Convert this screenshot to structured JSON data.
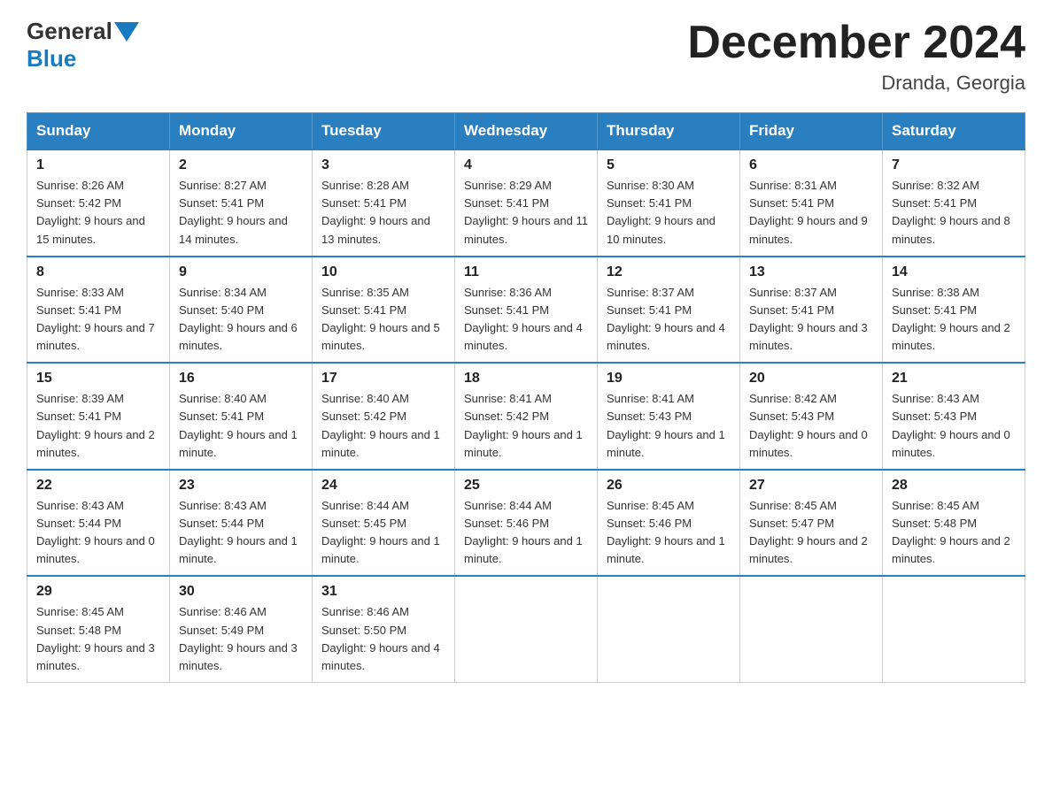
{
  "header": {
    "title": "December 2024",
    "location": "Dranda, Georgia",
    "logo_general": "General",
    "logo_blue": "Blue"
  },
  "days_of_week": [
    "Sunday",
    "Monday",
    "Tuesday",
    "Wednesday",
    "Thursday",
    "Friday",
    "Saturday"
  ],
  "weeks": [
    [
      {
        "day": 1,
        "sunrise": "8:26 AM",
        "sunset": "5:42 PM",
        "daylight": "9 hours and 15 minutes."
      },
      {
        "day": 2,
        "sunrise": "8:27 AM",
        "sunset": "5:41 PM",
        "daylight": "9 hours and 14 minutes."
      },
      {
        "day": 3,
        "sunrise": "8:28 AM",
        "sunset": "5:41 PM",
        "daylight": "9 hours and 13 minutes."
      },
      {
        "day": 4,
        "sunrise": "8:29 AM",
        "sunset": "5:41 PM",
        "daylight": "9 hours and 11 minutes."
      },
      {
        "day": 5,
        "sunrise": "8:30 AM",
        "sunset": "5:41 PM",
        "daylight": "9 hours and 10 minutes."
      },
      {
        "day": 6,
        "sunrise": "8:31 AM",
        "sunset": "5:41 PM",
        "daylight": "9 hours and 9 minutes."
      },
      {
        "day": 7,
        "sunrise": "8:32 AM",
        "sunset": "5:41 PM",
        "daylight": "9 hours and 8 minutes."
      }
    ],
    [
      {
        "day": 8,
        "sunrise": "8:33 AM",
        "sunset": "5:41 PM",
        "daylight": "9 hours and 7 minutes."
      },
      {
        "day": 9,
        "sunrise": "8:34 AM",
        "sunset": "5:40 PM",
        "daylight": "9 hours and 6 minutes."
      },
      {
        "day": 10,
        "sunrise": "8:35 AM",
        "sunset": "5:41 PM",
        "daylight": "9 hours and 5 minutes."
      },
      {
        "day": 11,
        "sunrise": "8:36 AM",
        "sunset": "5:41 PM",
        "daylight": "9 hours and 4 minutes."
      },
      {
        "day": 12,
        "sunrise": "8:37 AM",
        "sunset": "5:41 PM",
        "daylight": "9 hours and 4 minutes."
      },
      {
        "day": 13,
        "sunrise": "8:37 AM",
        "sunset": "5:41 PM",
        "daylight": "9 hours and 3 minutes."
      },
      {
        "day": 14,
        "sunrise": "8:38 AM",
        "sunset": "5:41 PM",
        "daylight": "9 hours and 2 minutes."
      }
    ],
    [
      {
        "day": 15,
        "sunrise": "8:39 AM",
        "sunset": "5:41 PM",
        "daylight": "9 hours and 2 minutes."
      },
      {
        "day": 16,
        "sunrise": "8:40 AM",
        "sunset": "5:41 PM",
        "daylight": "9 hours and 1 minute."
      },
      {
        "day": 17,
        "sunrise": "8:40 AM",
        "sunset": "5:42 PM",
        "daylight": "9 hours and 1 minute."
      },
      {
        "day": 18,
        "sunrise": "8:41 AM",
        "sunset": "5:42 PM",
        "daylight": "9 hours and 1 minute."
      },
      {
        "day": 19,
        "sunrise": "8:41 AM",
        "sunset": "5:43 PM",
        "daylight": "9 hours and 1 minute."
      },
      {
        "day": 20,
        "sunrise": "8:42 AM",
        "sunset": "5:43 PM",
        "daylight": "9 hours and 0 minutes."
      },
      {
        "day": 21,
        "sunrise": "8:43 AM",
        "sunset": "5:43 PM",
        "daylight": "9 hours and 0 minutes."
      }
    ],
    [
      {
        "day": 22,
        "sunrise": "8:43 AM",
        "sunset": "5:44 PM",
        "daylight": "9 hours and 0 minutes."
      },
      {
        "day": 23,
        "sunrise": "8:43 AM",
        "sunset": "5:44 PM",
        "daylight": "9 hours and 1 minute."
      },
      {
        "day": 24,
        "sunrise": "8:44 AM",
        "sunset": "5:45 PM",
        "daylight": "9 hours and 1 minute."
      },
      {
        "day": 25,
        "sunrise": "8:44 AM",
        "sunset": "5:46 PM",
        "daylight": "9 hours and 1 minute."
      },
      {
        "day": 26,
        "sunrise": "8:45 AM",
        "sunset": "5:46 PM",
        "daylight": "9 hours and 1 minute."
      },
      {
        "day": 27,
        "sunrise": "8:45 AM",
        "sunset": "5:47 PM",
        "daylight": "9 hours and 2 minutes."
      },
      {
        "day": 28,
        "sunrise": "8:45 AM",
        "sunset": "5:48 PM",
        "daylight": "9 hours and 2 minutes."
      }
    ],
    [
      {
        "day": 29,
        "sunrise": "8:45 AM",
        "sunset": "5:48 PM",
        "daylight": "9 hours and 3 minutes."
      },
      {
        "day": 30,
        "sunrise": "8:46 AM",
        "sunset": "5:49 PM",
        "daylight": "9 hours and 3 minutes."
      },
      {
        "day": 31,
        "sunrise": "8:46 AM",
        "sunset": "5:50 PM",
        "daylight": "9 hours and 4 minutes."
      },
      null,
      null,
      null,
      null
    ]
  ]
}
